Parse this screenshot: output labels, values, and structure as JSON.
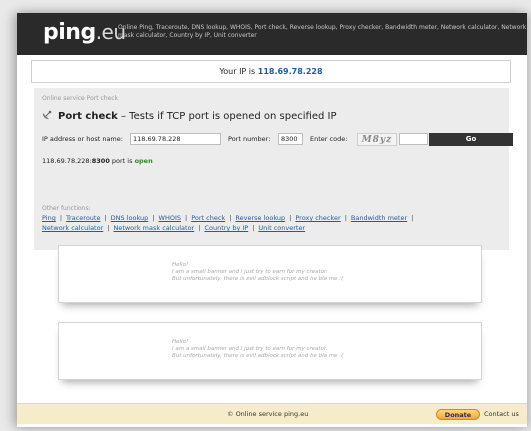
{
  "header": {
    "logo_main": "ping",
    "logo_suffix": ".eu",
    "description": "Online Ping, Traceroute, DNS lookup, WHOIS, Port check, Reverse lookup, Proxy checker, Bandwidth meter, Network calculator, Network mask calculator, Country by IP, Unit converter"
  },
  "ip_bar": {
    "label": "Your IP is",
    "ip": "118.69.78.228"
  },
  "tool": {
    "breadcrumb": "Online service Port check",
    "title_bold": "Port check",
    "title_rest": " – Tests if TCP port is opened on specified IP",
    "icon": "satellite-dish-icon"
  },
  "form": {
    "host_label": "IP address or host name:",
    "host_value": "118.69.78.228",
    "port_label": "Port number:",
    "port_value": "8300",
    "code_label": "Enter code:",
    "captcha_text": "M8yz",
    "code_value": "",
    "go_label": "Go"
  },
  "result": {
    "prefix": "118.69.78.228:",
    "port": "8300",
    "middle": " port is ",
    "status": "open"
  },
  "other": {
    "heading": "Other functions:",
    "links": [
      "Ping",
      "Traceroute",
      "DNS lookup",
      "WHOIS",
      "Port check",
      "Reverse lookup",
      "Proxy checker",
      "Bandwidth meter",
      "Network calculator",
      "Network mask calculator",
      "Country by IP",
      "Unit converter"
    ]
  },
  "banner": {
    "line1": "Hello!",
    "line2": "I am a small banner and I just try to earn for my creator.",
    "line3": "But unfortunately, there is evil adblock script and he bla me :("
  },
  "footer": {
    "copyright": "© Online service ping.eu",
    "donate": "Donate",
    "contact": "Contact us"
  },
  "colors": {
    "header_bg": "#2a2a2a",
    "link": "#1a5fa6",
    "open": "#2a8a22",
    "footer_bg": "#f7ecc9"
  }
}
